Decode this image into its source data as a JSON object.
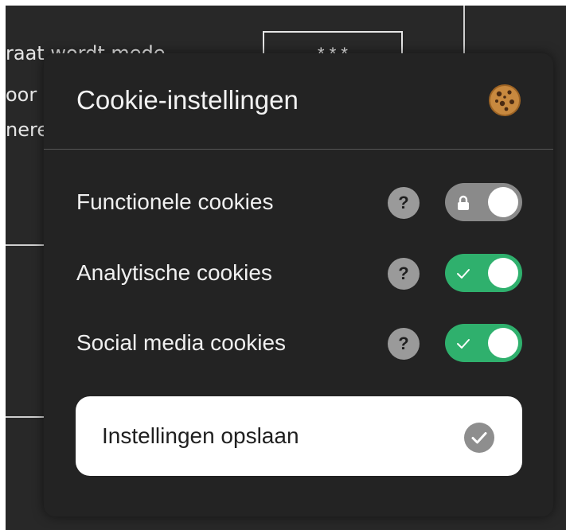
{
  "background": {
    "lines": [
      "raat wordt mede",
      "oor",
      "nere"
    ],
    "box_text": "* * *"
  },
  "panel": {
    "title": "Cookie-instellingen",
    "header_icon": "cookie-icon",
    "cookies": [
      {
        "label": "Functionele cookies",
        "help": "?",
        "state": "locked",
        "icon": "lock-icon"
      },
      {
        "label": "Analytische cookies",
        "help": "?",
        "state": "on",
        "icon": "check-icon"
      },
      {
        "label": "Social media cookies",
        "help": "?",
        "state": "on",
        "icon": "check-icon"
      }
    ],
    "save_label": "Instellingen opslaan",
    "save_icon": "check-circle-icon"
  },
  "colors": {
    "panel_bg": "#232323",
    "toggle_on": "#2fb06d",
    "toggle_locked": "#8a8a8a",
    "button_bg": "#ffffff"
  }
}
